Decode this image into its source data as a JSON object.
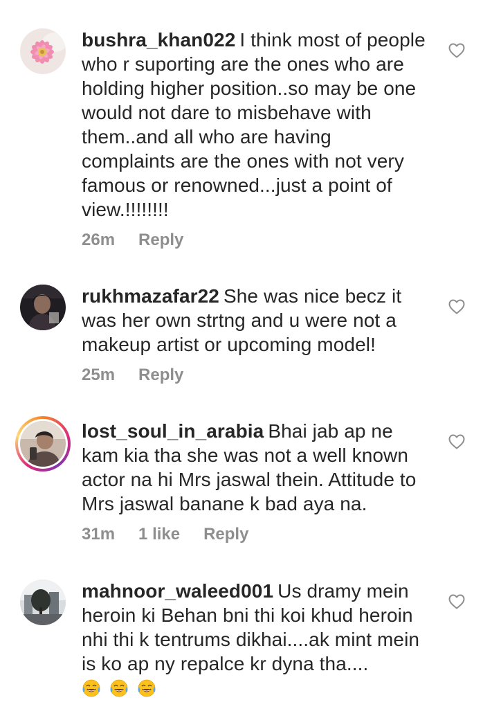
{
  "comments": [
    {
      "username": "bushra_khan022",
      "text": "I think most of people who r suporting are the ones who are holding higher position..so may be one would not dare to misbehave with them..and all who are having complaints are the ones with not very famous or renowned...just a point of view.!!!!!!!!",
      "time": "26m",
      "reply": "Reply",
      "avatar_icon": "pink-flower-avatar"
    },
    {
      "username": "rukhmazafar22",
      "text": "She was nice becz it was her own strtng and u were not a makeup artist or upcoming model!",
      "time": "25m",
      "reply": "Reply",
      "avatar_icon": "person-dark-avatar"
    },
    {
      "username": "lost_soul_in_arabia",
      "text": "Bhai jab ap ne kam kia tha she was not a well known actor na hi Mrs jaswal thein. Attitude to Mrs jaswal banane k bad aya na.",
      "time": "31m",
      "likes": "1 like",
      "reply": "Reply",
      "avatar_icon": "person-selfie-avatar"
    },
    {
      "username": "mahnoor_waleed001",
      "text": "Us dramy mein heroin ki Behan bni thi koi khud heroin nhi thi k tentrums dikhai....ak mint mein is ko ap ny repalce kr dyna tha....",
      "emoji": "😂😂😂",
      "avatar_icon": "city-tree-avatar"
    }
  ],
  "icons": {
    "like": "heart-outline-icon",
    "emoji": "face-with-tears-of-joy-icon"
  },
  "colors": {
    "text": "#262626",
    "meta": "#8e8e8e",
    "heart": "#8e8e8e"
  }
}
